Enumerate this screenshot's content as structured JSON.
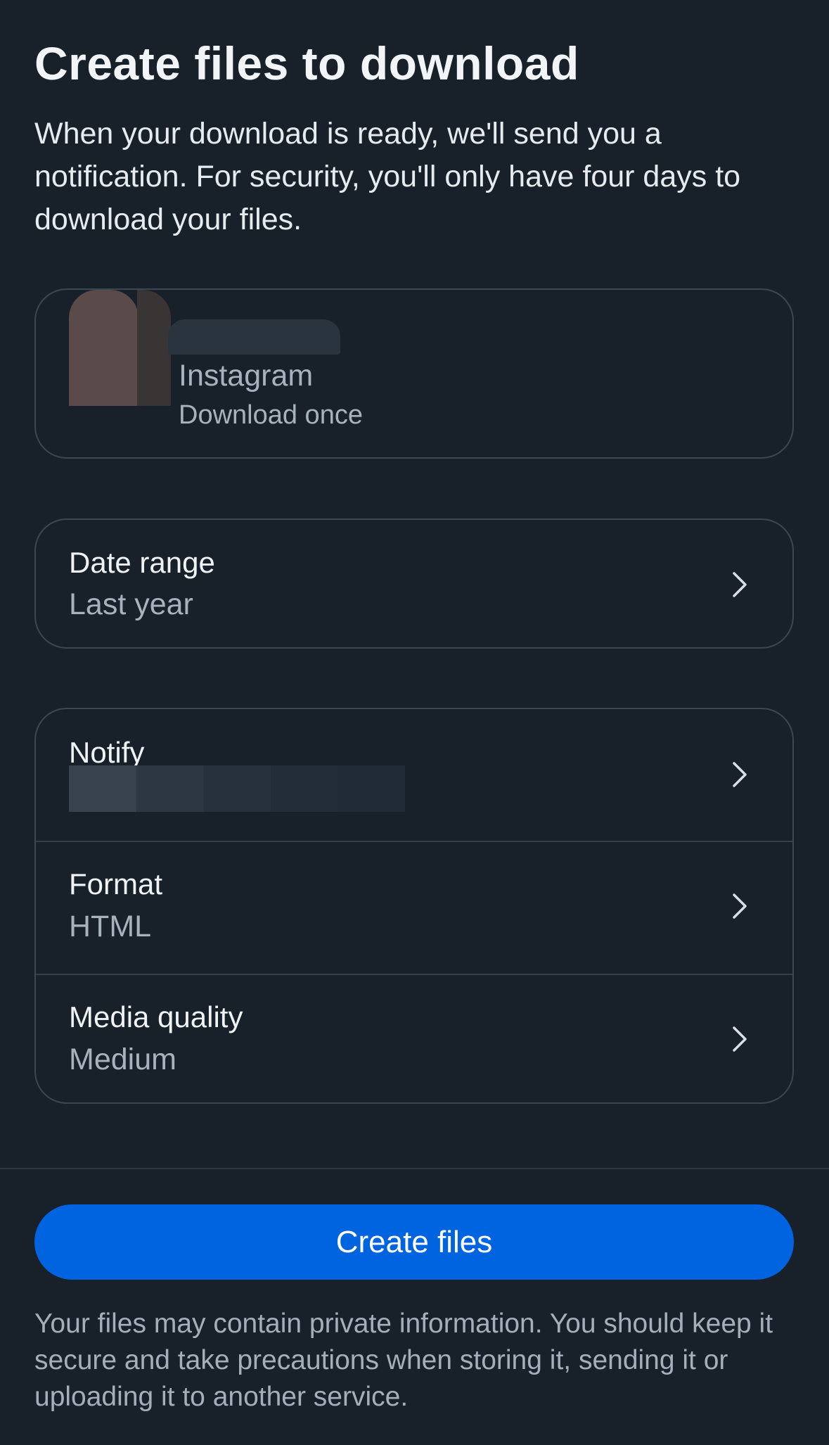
{
  "header": {
    "title": "Create files to download",
    "description": "When your download is ready, we'll send you a notification. For security, you'll only have four days to download your files."
  },
  "account": {
    "app": "Instagram",
    "frequency": "Download once"
  },
  "date_range": {
    "title": "Date range",
    "value": "Last year"
  },
  "settings": {
    "notify": {
      "title": "Notify"
    },
    "format": {
      "title": "Format",
      "value": "HTML"
    },
    "media_quality": {
      "title": "Media quality",
      "value": "Medium"
    }
  },
  "actions": {
    "create_label": "Create files",
    "button_color": "#0064E0"
  },
  "footer": {
    "disclaimer": "Your files may contain private information. You should keep it secure and take precautions when storing it, sending it or uploading it to another service."
  },
  "icons": {
    "chevron": "chevron-right-icon"
  }
}
